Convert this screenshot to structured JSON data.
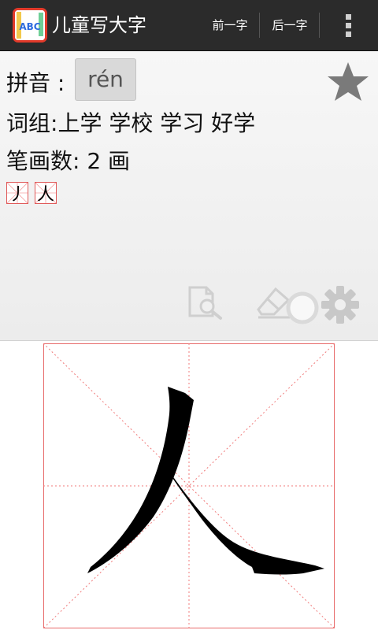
{
  "app": {
    "title": "儿童写大字",
    "icon_name": "app-abc-icon",
    "icon_text": "ABC"
  },
  "toolbar": {
    "prev_label": "前一字",
    "next_label": "后一字",
    "overflow_icon": "overflow-menu-icon"
  },
  "info": {
    "pinyin_label": "拼音 :",
    "pinyin_value": "rén",
    "words_label": "词组:",
    "words_value": "上学 学校 学习 好学",
    "strokes_label": "笔画数:",
    "strokes_value": "2 画",
    "stroke_steps": [
      "丿",
      "人"
    ],
    "favorite_icon": "star-icon"
  },
  "tools": {
    "search_icon": "document-search-icon",
    "eraser_icon": "eraser-icon",
    "loading_icon": "loading-ring-icon",
    "settings_icon": "gear-icon"
  },
  "writing": {
    "character": "人",
    "grid_style": "米字格",
    "accent_color": "#e23a2a",
    "grid_color": "#f07a7a"
  }
}
